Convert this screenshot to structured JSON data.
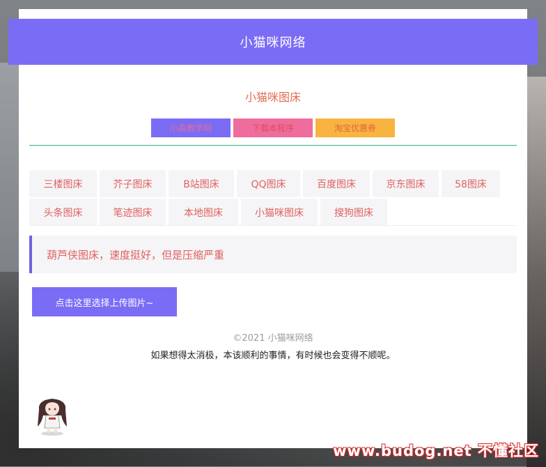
{
  "header": {
    "title": "小猫咪网络"
  },
  "subtitle": "小猫咪图床",
  "nav_buttons": [
    {
      "label": "小高教学网"
    },
    {
      "label": "下载本程序"
    },
    {
      "label": "淘宝优惠券"
    }
  ],
  "tabs_row1": [
    "三楼图床",
    "芥子图床",
    "B站图床",
    "QQ图床",
    "百度图床",
    "京东图床",
    "58图床"
  ],
  "tabs_row2": [
    "头条图床",
    "笔迹图床",
    "本地图床",
    "小猫咪图床",
    "搜狗图床"
  ],
  "notice": "葫芦侠图床，速度挺好，但是压缩严重",
  "upload_button": "点击这里选择上传图片~",
  "footer": {
    "copyright": "©2021 小猫咪网络",
    "quote": "如果想得太消极，本该顺利的事情，有时候也会变得不顺呢。"
  },
  "watermark": "www.budog.net 不懂社区",
  "colors": {
    "accent": "#7b6cf6",
    "pink": "#ef6d9c",
    "orange": "#f8b340",
    "text_red": "#e0605e",
    "divider": "#2eae87"
  },
  "icons": {
    "mascot": "anime-girl-mascot-icon"
  }
}
